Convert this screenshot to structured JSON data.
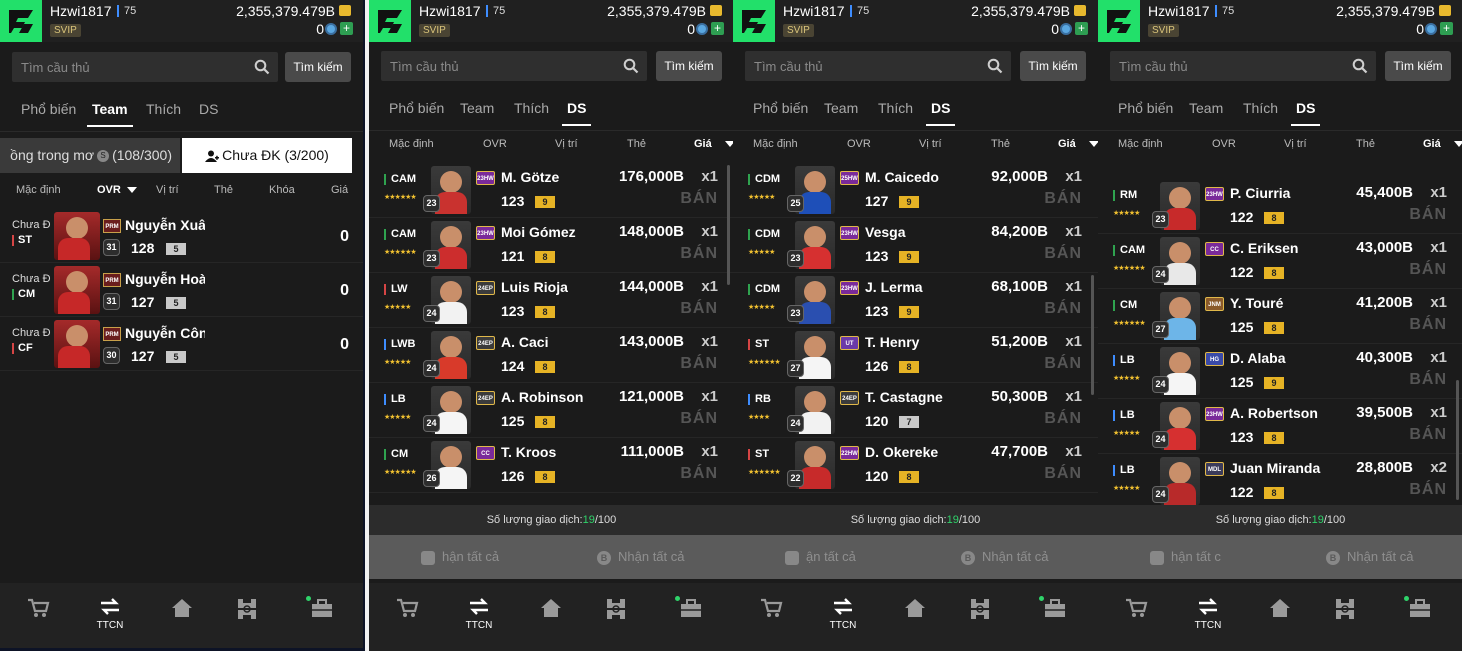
{
  "header": {
    "username": "Hzwi1817",
    "level": "75",
    "vip": "SVIP",
    "coins": "2,355,379.479B",
    "gems": "0"
  },
  "search": {
    "placeholder": "Tìm cầu thủ",
    "button": "Tìm kiếm"
  },
  "tabs": [
    "Phổ biến",
    "Team",
    "Thích",
    "DS"
  ],
  "team_panel": {
    "active_tab": 1,
    "segment_left": "ồng trong mơ",
    "segment_left_count": "(108/300)",
    "segment_right": "Chưa ĐK (3/200)",
    "columns": [
      "Mặc định",
      "OVR",
      "Vị trí",
      "Thẻ",
      "Khóa",
      "Giá"
    ],
    "rows": [
      {
        "status": "Chưa Đ",
        "pos": "ST",
        "season": "PRM",
        "level": "31",
        "name": "Nguyễn Xuân",
        "ovr": "128",
        "grade": "5",
        "value": "0",
        "pos_color": "#d64545"
      },
      {
        "status": "Chưa Đ",
        "pos": "CM",
        "season": "PRM",
        "level": "31",
        "name": "Nguyễn Hoàn",
        "ovr": "127",
        "grade": "5",
        "value": "0",
        "pos_color": "#2fa34f"
      },
      {
        "status": "Chưa Đ",
        "pos": "CF",
        "season": "PRM",
        "level": "30",
        "name": "Nguyễn Công",
        "ovr": "127",
        "grade": "5",
        "value": "0",
        "pos_color": "#d64545"
      }
    ]
  },
  "list_columns": [
    "Mặc định",
    "OVR",
    "Vị trí",
    "Thẻ",
    "Giá"
  ],
  "sell_label": "BÁN",
  "trade": {
    "label": "Số lượng giao dịch:",
    "used": "19",
    "total": "/100"
  },
  "actions": {
    "receive_all": "Nhận tất cả",
    "left_p2": "hận tất cả",
    "left_p3": "ận tất cả",
    "left_p4": "hận tất c"
  },
  "nav": {
    "ttcn": "TTCN"
  },
  "ds_panels": [
    {
      "rows": [
        {
          "pos": "CAM",
          "stars": "★★★★★★",
          "season": "23HW",
          "season_color": "#7a2a9a",
          "level": "23",
          "name": "M. Götze",
          "ovr": "123",
          "grade": "9",
          "price": "176,000B",
          "qty": "x1",
          "shirt": "#c9322f",
          "card": "#2a2a2a",
          "pos_color": "#2fa34f"
        },
        {
          "pos": "CAM",
          "stars": "★★★★★★",
          "season": "23HW",
          "season_color": "#7a2a9a",
          "level": "23",
          "name": "Moi Gómez",
          "ovr": "121",
          "grade": "8",
          "price": "148,000B",
          "qty": "x1",
          "shirt": "#cc2d2d",
          "card": "#2a2a2a",
          "pos_color": "#2fa34f"
        },
        {
          "pos": "LW",
          "stars": "★★★★★",
          "season": "24EP",
          "season_color": "#3b3b3b",
          "level": "24",
          "name": "Luis Rioja",
          "ovr": "123",
          "grade": "8",
          "price": "144,000B",
          "qty": "x1",
          "shirt": "#f2f2f2",
          "card": "#2a2a2a",
          "pos_color": "#d64545"
        },
        {
          "pos": "LWB",
          "stars": "★★★★★",
          "season": "24EP",
          "season_color": "#3b3b3b",
          "level": "24",
          "name": "A. Caci",
          "ovr": "124",
          "grade": "8",
          "price": "143,000B",
          "qty": "x1",
          "shirt": "#d83a2a",
          "card": "#2a2a2a",
          "pos_color": "#3e8dff"
        },
        {
          "pos": "LB",
          "stars": "★★★★★",
          "season": "24EP",
          "season_color": "#3b3b3b",
          "level": "24",
          "name": "A. Robinson",
          "ovr": "125",
          "grade": "8",
          "price": "121,000B",
          "qty": "x1",
          "shirt": "#f5f5f5",
          "card": "#2a2a2a",
          "pos_color": "#3e8dff"
        },
        {
          "pos": "CM",
          "stars": "★★★★★★",
          "season": "CC",
          "season_color": "#7a2a9a",
          "level": "26",
          "name": "T. Kroos",
          "ovr": "126",
          "grade": "8",
          "price": "111,000B",
          "qty": "x1",
          "shirt": "#f5f5f5",
          "card": "#2a2a2a",
          "pos_color": "#2fa34f"
        }
      ]
    },
    {
      "rows": [
        {
          "pos": "CDM",
          "stars": "★★★★★",
          "season": "25HW",
          "season_color": "#7a2a9a",
          "level": "25",
          "name": "M. Caicedo",
          "ovr": "127",
          "grade": "9",
          "price": "92,000B",
          "qty": "x1",
          "shirt": "#1e4fb8",
          "card": "#2a2a2a",
          "pos_color": "#2fa34f"
        },
        {
          "pos": "CDM",
          "stars": "★★★★★",
          "season": "23HW",
          "season_color": "#7a2a9a",
          "level": "23",
          "name": "Vesga",
          "ovr": "123",
          "grade": "9",
          "price": "84,200B",
          "qty": "x1",
          "shirt": "#d63030",
          "card": "#2a2a2a",
          "pos_color": "#2fa34f"
        },
        {
          "pos": "CDM",
          "stars": "★★★★★",
          "season": "23HW",
          "season_color": "#7a2a9a",
          "level": "23",
          "name": "J. Lerma",
          "ovr": "123",
          "grade": "9",
          "price": "68,100B",
          "qty": "x1",
          "shirt": "#2a4fb0",
          "card": "#2a2a2a",
          "pos_color": "#2fa34f"
        },
        {
          "pos": "ST",
          "stars": "★★★★★★",
          "season": "UT",
          "season_color": "#6a3aa8",
          "level": "27",
          "name": "T. Henry",
          "ovr": "126",
          "grade": "8",
          "price": "51,200B",
          "qty": "x1",
          "shirt": "#f5f5f5",
          "card": "#2a2a2a",
          "pos_color": "#d64545"
        },
        {
          "pos": "RB",
          "stars": "★★★★",
          "season": "24EP",
          "season_color": "#3b3b3b",
          "level": "24",
          "name": "T. Castagne",
          "ovr": "120",
          "grade": "7",
          "price": "50,300B",
          "qty": "x1",
          "shirt": "#f2f2f2",
          "card": "#2a2a2a",
          "pos_color": "#3e8dff"
        },
        {
          "pos": "ST",
          "stars": "★★★★★★",
          "season": "22HW",
          "season_color": "#7a2a9a",
          "level": "22",
          "name": "D. Okereke",
          "ovr": "120",
          "grade": "8",
          "price": "47,700B",
          "qty": "x1",
          "shirt": "#c72a2a",
          "card": "#2a2a2a",
          "pos_color": "#d64545"
        }
      ]
    },
    {
      "rows": [
        {
          "pos": "RM",
          "stars": "★★★★★",
          "season": "23HW",
          "season_color": "#7a2a9a",
          "level": "23",
          "name": "P. Ciurria",
          "ovr": "122",
          "grade": "8",
          "price": "45,400B",
          "qty": "x1",
          "shirt": "#c72a2a",
          "card": "#2a2a2a",
          "pos_color": "#2fa34f"
        },
        {
          "pos": "CAM",
          "stars": "★★★★★★",
          "season": "CC",
          "season_color": "#7a2a9a",
          "level": "24",
          "name": "C. Eriksen",
          "ovr": "122",
          "grade": "8",
          "price": "43,000B",
          "qty": "x1",
          "shirt": "#e8e8e8",
          "card": "#2a2a2a",
          "pos_color": "#2fa34f"
        },
        {
          "pos": "CM",
          "stars": "★★★★★★",
          "season": "JNM",
          "season_color": "#8a5a2a",
          "level": "27",
          "name": "Y. Touré",
          "ovr": "125",
          "grade": "8",
          "price": "41,200B",
          "qty": "x1",
          "shirt": "#6db5e8",
          "card": "#2a2a2a",
          "pos_color": "#2fa34f"
        },
        {
          "pos": "LB",
          "stars": "★★★★★",
          "season": "HG",
          "season_color": "#3a4aa8",
          "level": "24",
          "name": "D. Alaba",
          "ovr": "125",
          "grade": "9",
          "price": "40,300B",
          "qty": "x1",
          "shirt": "#f5f5f5",
          "card": "#2a2a2a",
          "pos_color": "#3e8dff"
        },
        {
          "pos": "LB",
          "stars": "★★★★★",
          "season": "23HW",
          "season_color": "#7a2a9a",
          "level": "24",
          "name": "A. Robertson",
          "ovr": "123",
          "grade": "8",
          "price": "39,500B",
          "qty": "x1",
          "shirt": "#d63030",
          "card": "#2a2a2a",
          "pos_color": "#3e8dff"
        },
        {
          "pos": "LB",
          "stars": "★★★★★",
          "season": "MDL",
          "season_color": "#3b3b5a",
          "level": "24",
          "name": "Juan Miranda",
          "ovr": "122",
          "grade": "8",
          "price": "28,800B",
          "qty": "x2",
          "shirt": "#b82a2a",
          "card": "#2a2a2a",
          "pos_color": "#3e8dff"
        }
      ]
    }
  ]
}
